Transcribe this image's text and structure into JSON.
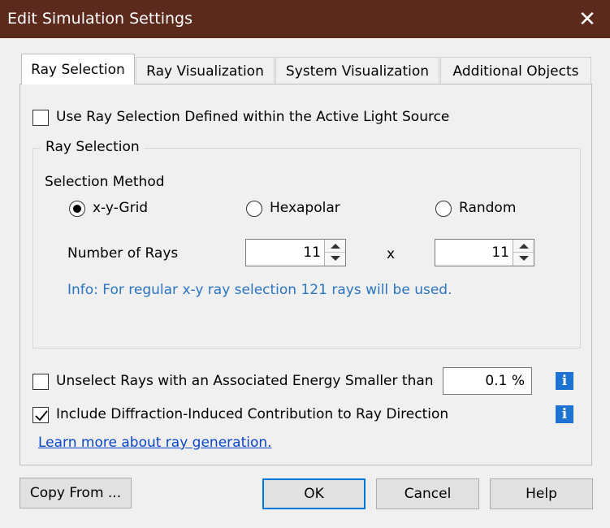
{
  "window": {
    "title": "Edit Simulation Settings"
  },
  "tabs": [
    {
      "label": "Ray Selection"
    },
    {
      "label": "Ray Visualization"
    },
    {
      "label": "System Visualization"
    },
    {
      "label": "Additional Objects"
    }
  ],
  "use_source_selection": {
    "label": "Use Ray Selection Defined within the Active Light Source",
    "checked": false
  },
  "ray_selection_group": {
    "title": "Ray Selection",
    "method_label": "Selection Method",
    "methods": [
      {
        "label": "x-y-Grid",
        "selected": true
      },
      {
        "label": "Hexapolar",
        "selected": false
      },
      {
        "label": "Random",
        "selected": false
      }
    ],
    "num_rays_label": "Number of Rays",
    "num_rays_x": "11",
    "times_symbol": "x",
    "num_rays_y": "11",
    "info_text": "Info: For regular x-y ray selection 121 rays will be used."
  },
  "unselect_energy": {
    "label": "Unselect Rays with an Associated Energy Smaller than",
    "checked": false,
    "value": "0.1 %"
  },
  "diffraction": {
    "label": "Include Diffraction-Induced Contribution to Ray Direction",
    "checked": true
  },
  "learn_more_link": "Learn more about ray generation.",
  "buttons": {
    "copy_from": "Copy From ...",
    "ok": "OK",
    "cancel": "Cancel",
    "help": "Help"
  },
  "colors": {
    "titlebar": "#5b2a1c",
    "link": "#0a46c8",
    "info_text": "#2a74c0",
    "info_icon": "#1e72d2"
  },
  "icons": {
    "close": "close-icon",
    "info": "info-icon",
    "checkmark": "checkmark-icon"
  }
}
